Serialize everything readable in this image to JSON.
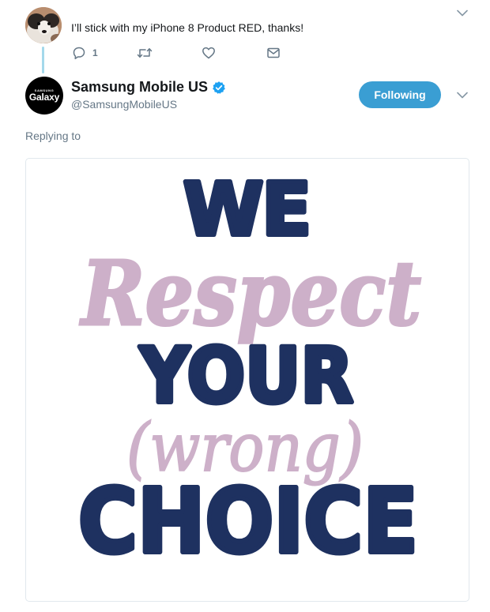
{
  "parent_tweet": {
    "text": "I’ll stick with my iPhone 8 Product RED, thanks!",
    "reply_count": "1",
    "avatar_icon": "dog-photo-avatar"
  },
  "main_tweet": {
    "display_name": "Samsung Mobile US",
    "handle": "@SamsungMobileUS",
    "verified": true,
    "follow_button_label": "Following",
    "replying_label": "Replying to",
    "avatar": {
      "brand_small": "SAMSUNG",
      "brand_big": "Galaxy"
    }
  },
  "image": {
    "lines": [
      "WE",
      "Respect",
      "YOUR",
      "(wrong)",
      "CHOICE"
    ]
  },
  "colors": {
    "navy": "#1e3160",
    "lilac": "#cdb0c9",
    "accent": "#3a9ed3",
    "muted": "#657786"
  }
}
